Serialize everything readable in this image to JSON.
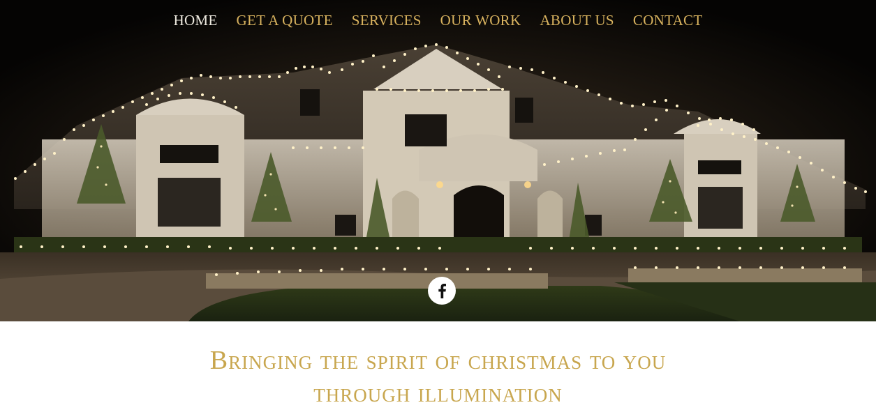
{
  "nav": {
    "items": [
      {
        "label": "HOME",
        "active": true
      },
      {
        "label": "GET A QUOTE",
        "active": false
      },
      {
        "label": "SERVICES",
        "active": false
      },
      {
        "label": "OUR WORK",
        "active": false
      },
      {
        "label": "ABOUT US",
        "active": false
      },
      {
        "label": "CONTACT",
        "active": false
      }
    ]
  },
  "hero": {
    "image_subject": "house-with-christmas-lights-at-night",
    "social": {
      "icon": "facebook-icon"
    }
  },
  "tagline": {
    "line1_first": "B",
    "line1_rest": "ringing the spirit of christmas to you",
    "line2": "through illumination"
  },
  "colors": {
    "accent_gold": "#d9b35f",
    "nav_active": "#eeeae0",
    "tagline_gold": "#c8a64e",
    "hero_bg": "#050403"
  }
}
